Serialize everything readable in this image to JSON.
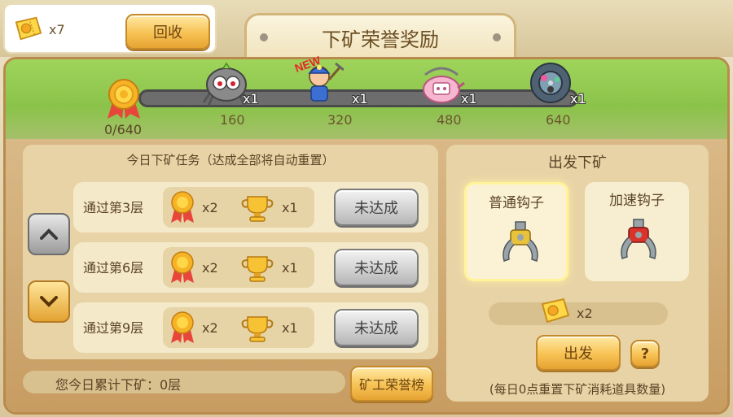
{
  "top": {
    "ticket_count": "x7",
    "recycle_label": "回收"
  },
  "title": "下矿荣誉奖励",
  "progress": {
    "current_text": "0/640",
    "value": 0,
    "max": 640,
    "rewards": [
      {
        "icon": "spider-robot-icon",
        "qty": "x1",
        "milestone": "160",
        "new": false
      },
      {
        "icon": "miner-character-icon",
        "qty": "x1",
        "milestone": "320",
        "new": true,
        "new_label": "NEW"
      },
      {
        "icon": "pink-teapot-icon",
        "qty": "x1",
        "milestone": "480",
        "new": false
      },
      {
        "icon": "gear-ball-icon",
        "qty": "x1",
        "milestone": "640",
        "new": false
      }
    ]
  },
  "tasks": {
    "title": "今日下矿任务（达成全部将自动重置）",
    "items": [
      {
        "name": "通过第3层",
        "medal_qty": "x2",
        "cup_qty": "x1",
        "status_label": "未达成"
      },
      {
        "name": "通过第6层",
        "medal_qty": "x2",
        "cup_qty": "x1",
        "status_label": "未达成"
      },
      {
        "name": "通过第9层",
        "medal_qty": "x2",
        "cup_qty": "x1",
        "status_label": "未达成"
      }
    ],
    "total_text": "您今日累计下矿：0层",
    "rank_label": "矿工荣誉榜"
  },
  "depart": {
    "title": "出发下矿",
    "hooks": [
      {
        "label": "普通钩子",
        "selected": true,
        "color": "#e9c23c"
      },
      {
        "label": "加速钩子",
        "selected": false,
        "color": "#d9342b"
      }
    ],
    "cost_qty": "x2",
    "go_label": "出发",
    "help_label": "?",
    "note": "(每日0点重置下矿消耗道具数量)"
  },
  "colors": {
    "accent": "#f7c254",
    "green": "#8bc34a",
    "text": "#5a4326"
  }
}
